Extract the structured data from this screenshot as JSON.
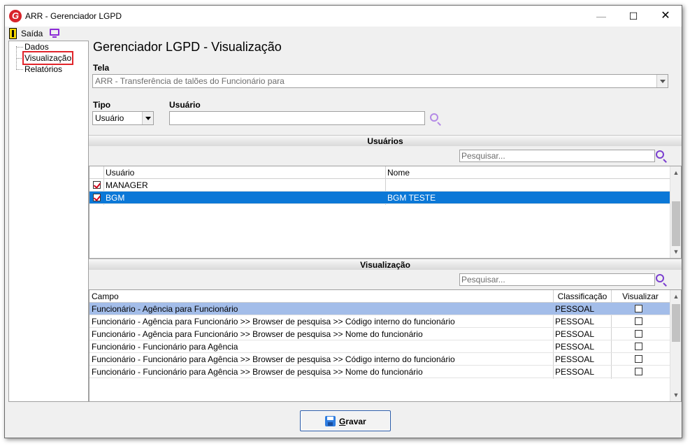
{
  "window": {
    "title": "ARR - Gerenciador LGPD",
    "logo_letter": "G",
    "min": "—",
    "max": "☐",
    "close": "✕"
  },
  "menubar": {
    "exit_label": "Saída"
  },
  "sidebar": {
    "items": [
      {
        "label": "Dados"
      },
      {
        "label": "Visualização"
      },
      {
        "label": "Relatórios"
      }
    ]
  },
  "main": {
    "title": "Gerenciador LGPD - Visualização",
    "tela_label": "Tela",
    "tela_value": "ARR - Transferência de talões do Funcionário para",
    "tipo_label": "Tipo",
    "tipo_value": "Usuário",
    "usuario_label": "Usuário",
    "usuario_value": ""
  },
  "usuarios": {
    "section_title": "Usuários",
    "search_placeholder": "Pesquisar...",
    "columns": [
      "Usuário",
      "Nome"
    ],
    "rows": [
      {
        "checked": true,
        "usuario": "MANAGER",
        "nome": ""
      },
      {
        "checked": true,
        "usuario": "BGM",
        "nome": "BGM TESTE"
      }
    ]
  },
  "visualizacao": {
    "section_title": "Visualização",
    "search_placeholder": "Pesquisar...",
    "columns": [
      "Campo",
      "Classificação",
      "Visualizar"
    ],
    "rows": [
      {
        "campo": "Funcionário - Agência para Funcionário",
        "classificacao": "PESSOAL",
        "visualizar": false
      },
      {
        "campo": "Funcionário - Agência para Funcionário >> Browser de pesquisa >> Código interno do funcionário",
        "classificacao": "PESSOAL",
        "visualizar": false
      },
      {
        "campo": "Funcionário - Agência para Funcionário >> Browser de pesquisa >> Nome do funcionário",
        "classificacao": "PESSOAL",
        "visualizar": false
      },
      {
        "campo": "Funcionário - Funcionário para Agência",
        "classificacao": "PESSOAL",
        "visualizar": false
      },
      {
        "campo": "Funcionário - Funcionário para Agência >> Browser de pesquisa >> Código interno do funcionário",
        "classificacao": "PESSOAL",
        "visualizar": false
      },
      {
        "campo": "Funcionário - Funcionário para Agência >> Browser de pesquisa >> Nome do funcionário",
        "classificacao": "PESSOAL",
        "visualizar": false
      }
    ]
  },
  "footer": {
    "save_mnemonic": "G",
    "save_rest": "ravar"
  },
  "colors": {
    "accent": "#0b78d7",
    "selection_light": "#a3bde9",
    "highlight_border": "#e1242a",
    "search_icon": "#7b3fd0"
  }
}
